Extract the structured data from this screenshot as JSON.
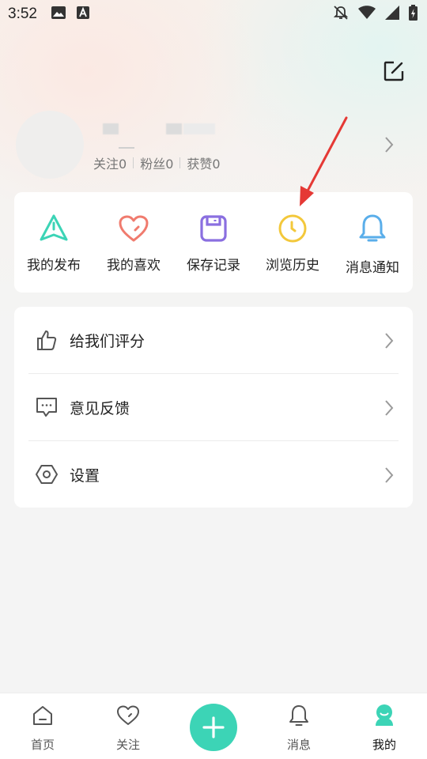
{
  "status_bar": {
    "time": "3:52",
    "icons": [
      "image-icon",
      "a-letter-icon",
      "mute-bell-icon",
      "wifi-icon",
      "signal-icon",
      "battery-charging-icon"
    ]
  },
  "header": {
    "edit_icon": "edit-icon"
  },
  "profile": {
    "stats": [
      {
        "label": "关注0"
      },
      {
        "label": "粉丝0"
      },
      {
        "label": "获赞0"
      }
    ]
  },
  "quick_actions": [
    {
      "label": "我的发布",
      "icon": "paper-plane-icon",
      "color": "#3cd4b6"
    },
    {
      "label": "我的喜欢",
      "icon": "heart-icon",
      "color": "#f07b6e"
    },
    {
      "label": "保存记录",
      "icon": "save-icon",
      "color": "#8a6fe0"
    },
    {
      "label": "浏览历史",
      "icon": "clock-icon",
      "color": "#f3c83b"
    },
    {
      "label": "消息通知",
      "icon": "bell-icon",
      "color": "#5aaeea"
    }
  ],
  "menu": [
    {
      "label": "给我们评分",
      "icon": "thumbs-up-icon"
    },
    {
      "label": "意见反馈",
      "icon": "feedback-icon"
    },
    {
      "label": "设置",
      "icon": "settings-hex-icon"
    }
  ],
  "bottom_nav": [
    {
      "label": "首页",
      "icon": "home-icon"
    },
    {
      "label": "关注",
      "icon": "heart-outline-icon"
    },
    {
      "label": "",
      "icon": "plus-icon"
    },
    {
      "label": "消息",
      "icon": "bell-outline-icon"
    },
    {
      "label": "我的",
      "icon": "profile-icon",
      "active": true
    }
  ],
  "colors": {
    "accent": "#3cd4b6",
    "annotation_arrow": "#e53935"
  }
}
